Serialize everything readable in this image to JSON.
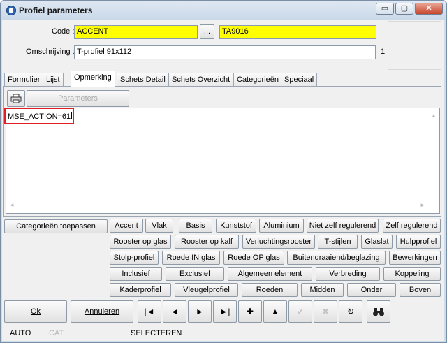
{
  "window": {
    "title": "Profiel parameters",
    "btn_min": "▭",
    "btn_max": "▢",
    "btn_close": "✕"
  },
  "form": {
    "code_label": "Code :",
    "code_value": "ACCENT",
    "code_browse": "...",
    "code_color": "TA9016",
    "omschrijving_label": "Omschrijving :",
    "omschrijving_value": "T-profiel 91x112",
    "counter": "1"
  },
  "tabs": [
    "Formulier",
    "Lijst",
    "Opmerking",
    "Schets Detail",
    "Schets Overzicht",
    "Categorieën",
    "Speciaal"
  ],
  "active_tab": "Opmerking",
  "opmerking": {
    "print_icon": "printer-icon",
    "parameters_label": "Parameters",
    "memo_text": "MSE_ACTION=61"
  },
  "categories": {
    "apply_label": "Categorieën toepassen",
    "rows": [
      [
        "Accent",
        "Vlak",
        "Basis",
        "Kunststof",
        "Aluminium",
        "Niet zelf regulerend",
        "Zelf regulerend"
      ],
      [
        "Rooster op glas",
        "Rooster op kalf",
        "Verluchtingsrooster",
        "T-stijlen",
        "Glaslat",
        "Hulpprofiel"
      ],
      [
        "Stolp-profiel",
        "Roede IN glas",
        "Roede OP glas",
        "Buitendraaiend/beglazing",
        "Bewerkingen"
      ],
      [
        "Inclusief",
        "Exclusief",
        "Algemeen element",
        "Verbreding",
        "Koppeling"
      ],
      [
        "Kaderprofiel",
        "Vleugelprofiel",
        "Roeden",
        "Midden",
        "Onder",
        "Boven"
      ]
    ]
  },
  "buttons": {
    "ok": "Ok",
    "annuleren": "Annuleren",
    "nav": [
      "|◄",
      "◄",
      "►",
      "►|",
      "✚",
      "▲",
      "✔",
      "✖",
      "↻",
      "⌕"
    ]
  },
  "status": {
    "auto": "AUTO",
    "cat": "CAT",
    "mode": "SELECTEREN"
  }
}
